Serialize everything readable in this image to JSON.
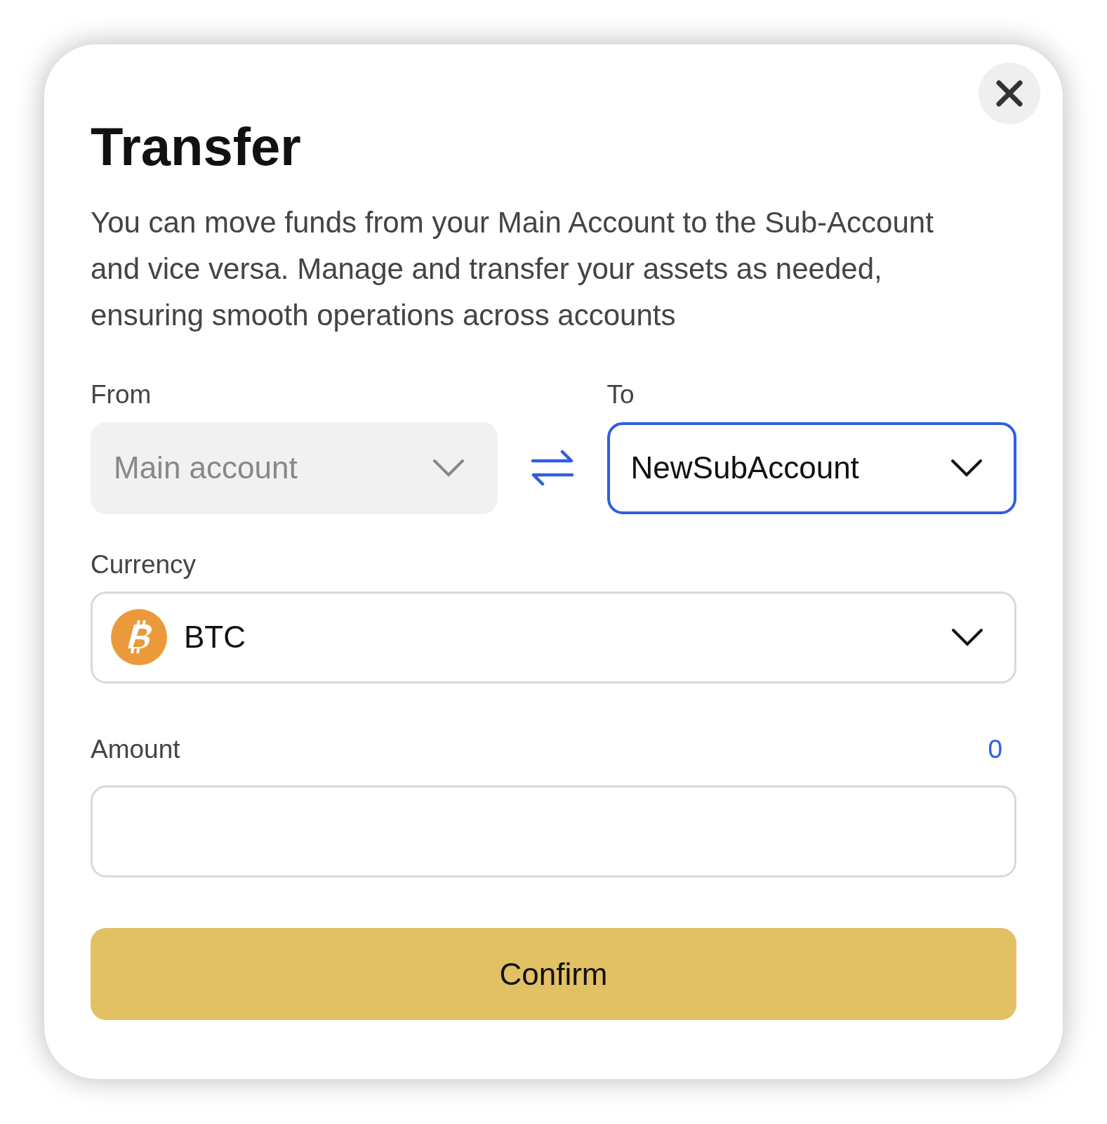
{
  "dialog": {
    "title": "Transfer",
    "description": "You can move funds from your Main Account to the Sub-Account and vice versa. Manage and transfer your assets as needed, ensuring smooth operations across accounts"
  },
  "from": {
    "label": "From",
    "value": "Main account",
    "disabled": true,
    "focused": false
  },
  "to": {
    "label": "To",
    "value": "NewSubAccount",
    "disabled": false,
    "focused": true
  },
  "currency": {
    "label": "Currency",
    "value": "BTC"
  },
  "amount": {
    "label": "Amount",
    "max": "0"
  },
  "confirm_button": "Confirm"
}
